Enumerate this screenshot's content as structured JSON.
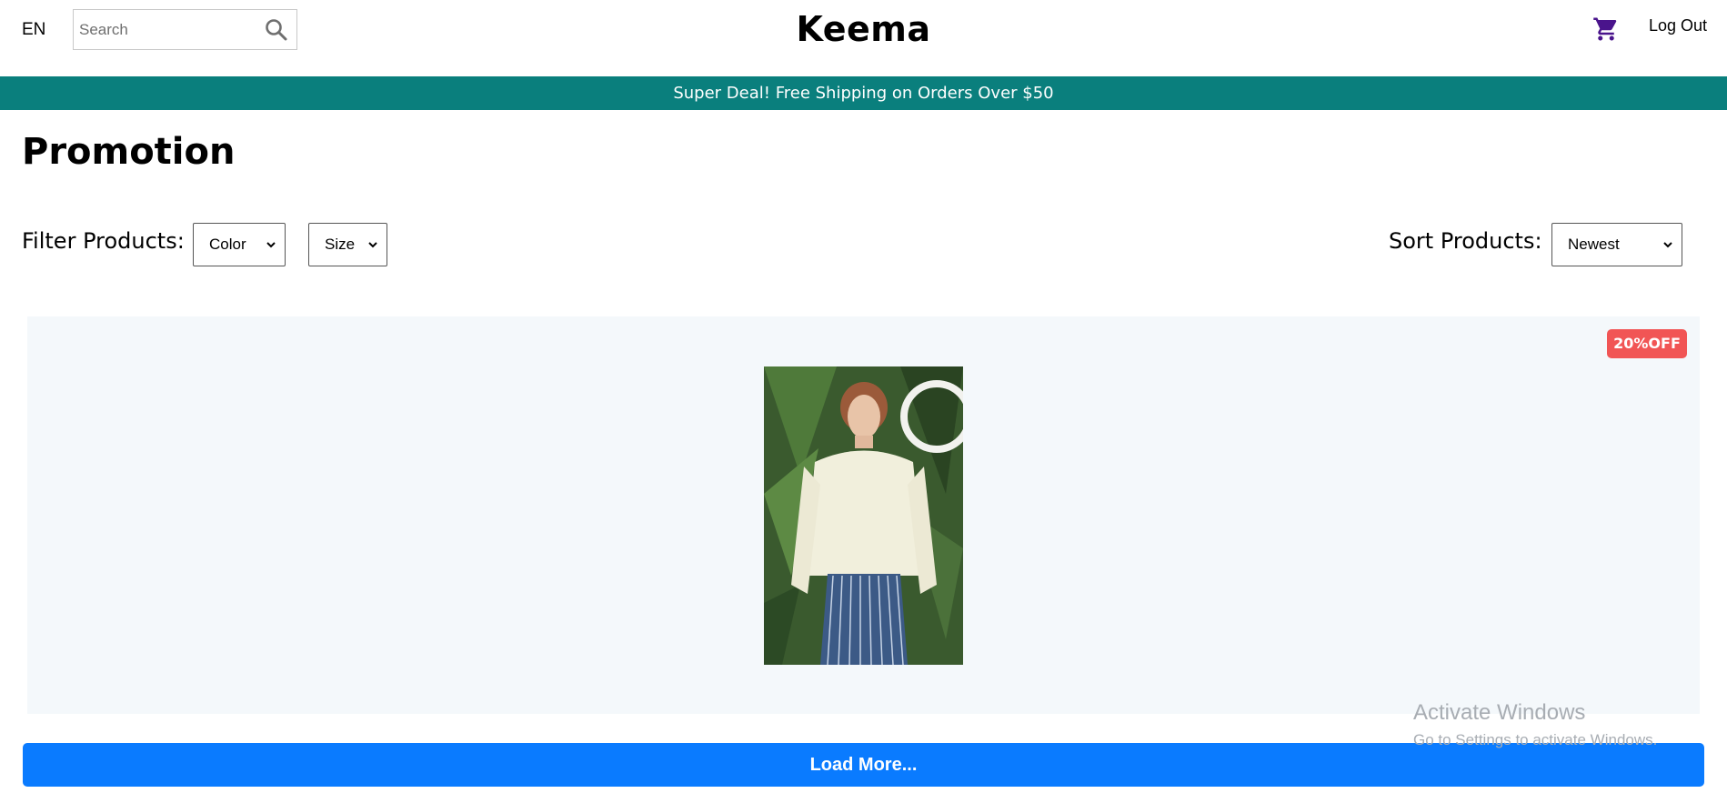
{
  "header": {
    "language": "EN",
    "search_placeholder": "Search",
    "logo": "Keema",
    "logout_label": "Log Out"
  },
  "announcement": "Super Deal! Free Shipping on Orders Over $50",
  "page": {
    "title": "Promotion"
  },
  "filters": {
    "filter_label": "Filter Products:",
    "color_selected": "Color",
    "size_selected": "Size",
    "sort_label": "Sort Products:",
    "sort_selected": "Newest"
  },
  "product": {
    "badge": "20%OFF"
  },
  "load_more_label": "Load More...",
  "os_watermark": {
    "title": "Activate Windows",
    "subtitle": "Go to Settings to activate Windows."
  },
  "colors": {
    "announcement_bg": "#0a7f7d",
    "badge_bg": "#f15555",
    "button_bg": "#0a7bff",
    "cart_icon": "#4a148c",
    "product_area_bg": "#f4f8fb"
  },
  "icons": [
    "search-icon",
    "cart-icon",
    "chevron-down-icon"
  ]
}
